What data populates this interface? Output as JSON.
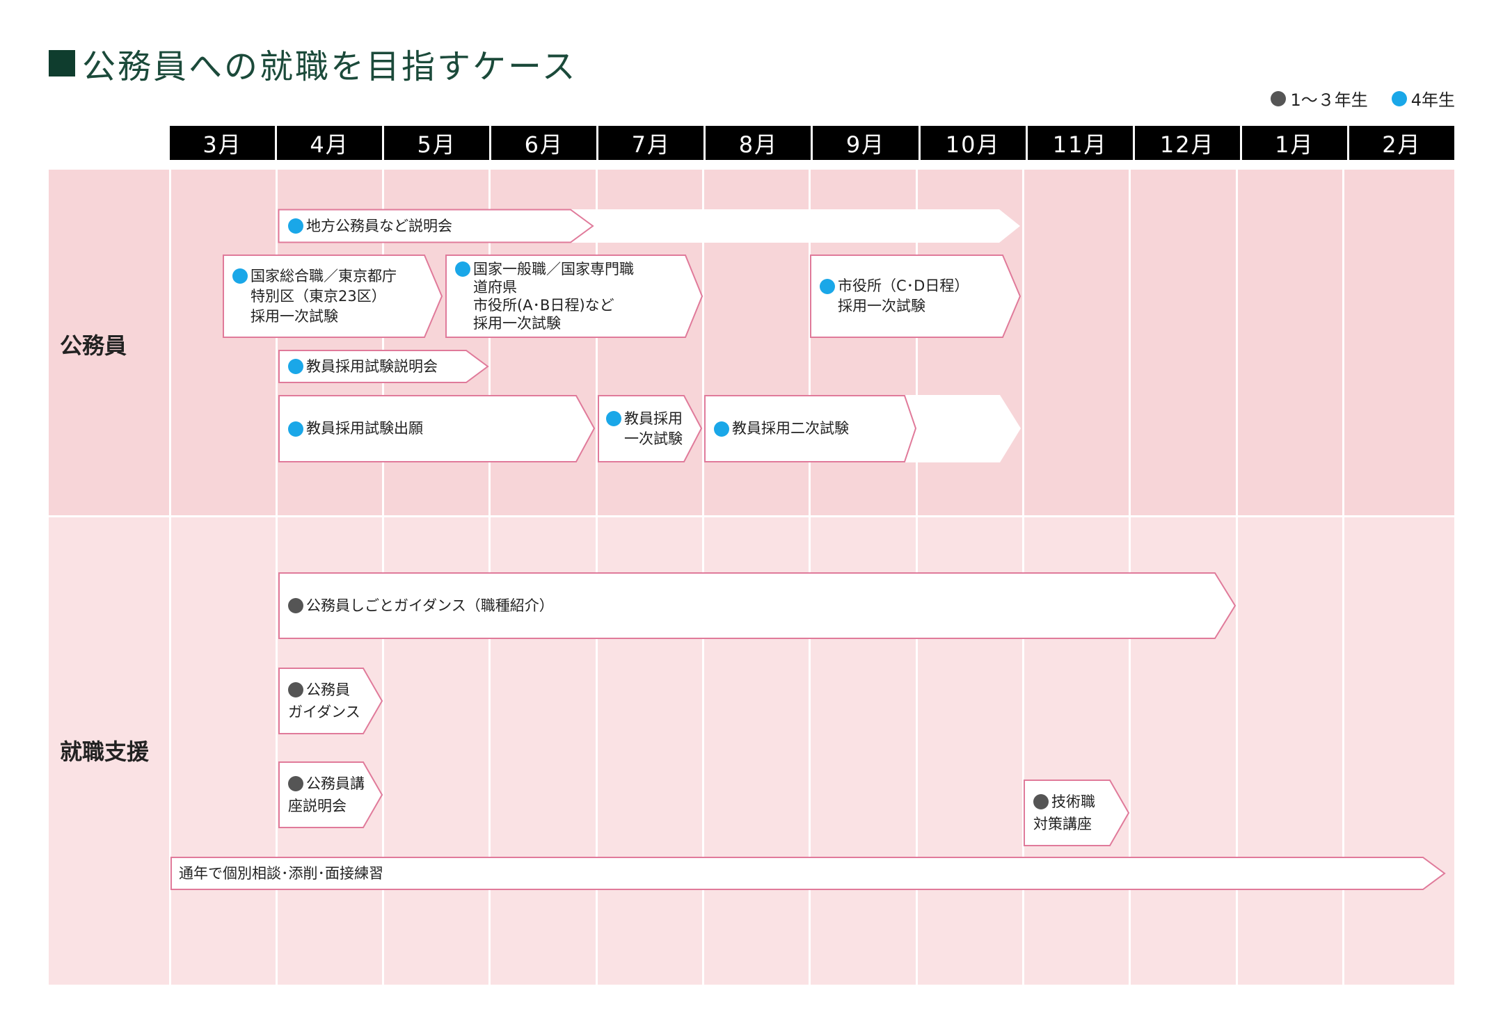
{
  "title": "公務員への就職を目指すケース",
  "legend": [
    {
      "label": "1〜３年生",
      "color": "#555555"
    },
    {
      "label": "4年生",
      "color": "#1aa7e8"
    }
  ],
  "months": [
    "3月",
    "4月",
    "5月",
    "6月",
    "7月",
    "8月",
    "9月",
    "10月",
    "11月",
    "12月",
    "1月",
    "2月"
  ],
  "sections": {
    "koumuin": "公務員",
    "shushoku": "就職支援"
  },
  "colors": {
    "blue": "#1aa7e8",
    "gray": "#555555",
    "border": "#e07a9a",
    "bg1": "#f7d5d8",
    "bg2": "#fae2e4"
  },
  "events": {
    "setsumeikai": {
      "line1": "地方公務員など説明会"
    },
    "kokka_sougou": {
      "line1": "国家総合職／東京都庁",
      "line2": "特別区（東京23区）",
      "line3": "採用一次試験"
    },
    "kokka_ippan": {
      "line1": "国家一般職／国家専門職",
      "line2": "道府県",
      "line3": "市役所(A･B日程)など",
      "line4": "採用一次試験"
    },
    "shiyakusho": {
      "line1": "市役所（C･D日程）",
      "line2": "採用一次試験"
    },
    "kyoin_setsumei": {
      "line1": "教員採用試験説明会"
    },
    "kyoin_shutsugan": {
      "line1": "教員採用試験出願"
    },
    "kyoin_ichiji": {
      "line1": "教員採用",
      "line2": "一次試験"
    },
    "kyoin_niji": {
      "line1": "教員採用二次試験"
    },
    "shigoto_guidance": {
      "line1": "公務員しごとガイダンス（職種紹介）"
    },
    "koumuin_guidance": {
      "line1": "公務員",
      "line2": "ガイダンス"
    },
    "koza_setsumei": {
      "line1": "公務員講",
      "line2": "座説明会"
    },
    "gijutsu": {
      "line1": "技術職",
      "line2": "対策講座"
    },
    "tsunen": {
      "line1": "通年で個別相談･添削･面接練習"
    }
  }
}
